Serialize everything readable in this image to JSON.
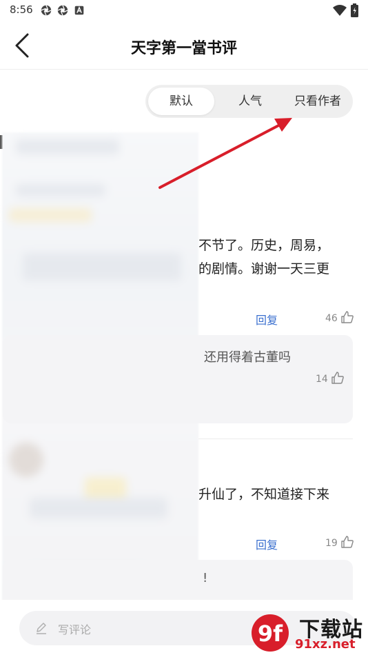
{
  "status_bar": {
    "time": "8:56",
    "left_icons": [
      "aperture-icon",
      "aperture-icon",
      "text-a-icon"
    ],
    "right_icons": [
      "wifi-icon",
      "battery-icon"
    ]
  },
  "header": {
    "title": "天字第一當书评"
  },
  "sort_tabs": [
    {
      "label": "默认",
      "active": true
    },
    {
      "label": "人气",
      "active": false
    },
    {
      "label": "只看作者",
      "active": false
    }
  ],
  "comments": [
    {
      "lines": [
        "不节了。历史，周易，",
        "的剧情。谢谢一天三更"
      ],
      "reply_label": "回复",
      "likes": "46",
      "reply": {
        "text": "还用得着古董吗",
        "likes": "14"
      }
    },
    {
      "lines": [
        "升仙了，不知道接下来"
      ],
      "reply_label": "回复",
      "likes": "19",
      "reply": {
        "text": "!"
      }
    }
  ],
  "bottom_bar": {
    "placeholder": "写评论"
  },
  "watermark": {
    "main": "下载站",
    "url": "91xz.net",
    "logo": "9f"
  },
  "colors": {
    "accent_link": "#3a6fcf",
    "arrow": "#d81e2a"
  }
}
